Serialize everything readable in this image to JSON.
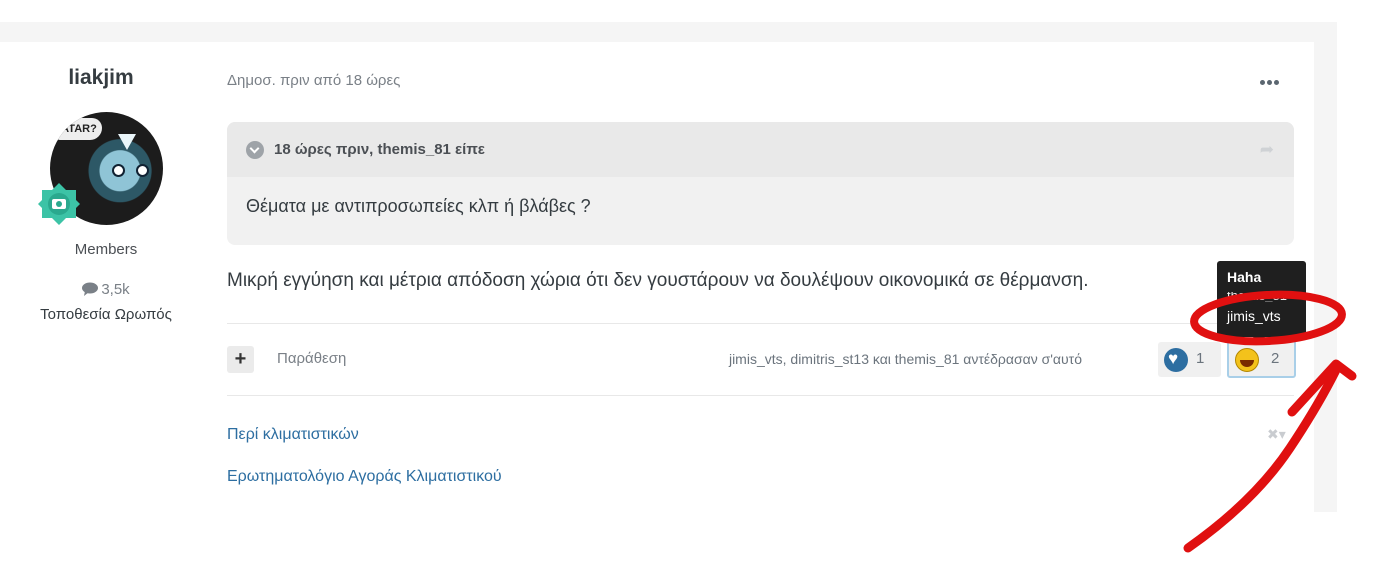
{
  "author": {
    "name": "liakjim",
    "avatar_text": "ATAR?",
    "group": "Members",
    "post_count": "3,5k",
    "location": "Τοποθεσία Ωρωπός"
  },
  "post": {
    "meta": "Δημοσ. πριν από 18 ώρες",
    "quote": {
      "header": "18 ώρες πριν, themis_81 είπε",
      "body": "Θέματα με αντιπροσωπείες κλπ ή βλάβες ?"
    },
    "text": "Μικρή εγγύηση και μέτρια απόδοση χώρια ότι δεν γουστάρουν να δουλέψουν οικονομικά σε θέρμανση."
  },
  "actions": {
    "plus_label": "+",
    "quote_label": "Παράθεση",
    "reacted_text": "jimis_vts, dimitris_st13 και themis_81 αντέδρασαν σ'αυτό",
    "reactions": [
      {
        "name": "Like",
        "icon": "heart-icon",
        "count": "1",
        "color": "#2d6ea1"
      },
      {
        "name": "Haha",
        "icon": "laughing-face-icon",
        "count": "2",
        "color": "#f3c21b"
      }
    ]
  },
  "tooltip": {
    "title": "Haha",
    "partial_user": "themis_81",
    "user": "jimis_vts"
  },
  "signature_links": [
    "Περί κλιματιστικών",
    "Ερωτηματολόγιο Αγοράς Κλιματιστικού"
  ],
  "colors": {
    "link": "#2d6ea1",
    "annotation_red": "#e01010",
    "badge_teal": "#3cc3a6"
  }
}
